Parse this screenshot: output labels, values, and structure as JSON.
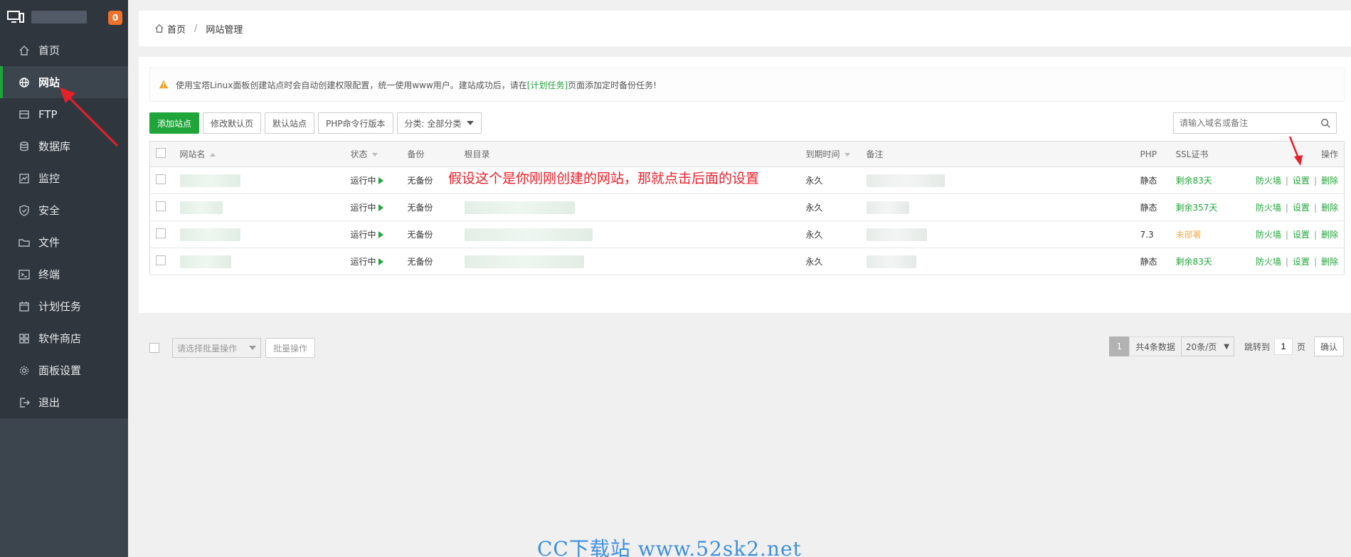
{
  "sidebar": {
    "badge": "0",
    "items": [
      {
        "label": "首页",
        "icon": "home-icon"
      },
      {
        "label": "网站",
        "icon": "globe-icon",
        "active": true
      },
      {
        "label": "FTP",
        "icon": "ftp-icon"
      },
      {
        "label": "数据库",
        "icon": "database-icon"
      },
      {
        "label": "监控",
        "icon": "monitor-icon"
      },
      {
        "label": "安全",
        "icon": "shield-icon"
      },
      {
        "label": "文件",
        "icon": "folder-icon"
      },
      {
        "label": "终端",
        "icon": "terminal-icon"
      },
      {
        "label": "计划任务",
        "icon": "calendar-icon"
      },
      {
        "label": "软件商店",
        "icon": "apps-icon"
      },
      {
        "label": "面板设置",
        "icon": "gear-icon"
      },
      {
        "label": "退出",
        "icon": "logout-icon"
      }
    ]
  },
  "breadcrumb": {
    "home": "首页",
    "sep": "/",
    "current": "网站管理"
  },
  "notice": {
    "before": "使用宝塔Linux面板创建站点时会自动创建权限配置，统一使用www用户。建站成功后，请在",
    "link": "[计划任务]",
    "after": "页面添加定时备份任务!"
  },
  "toolbar": {
    "add": "添加站点",
    "modify_default": "修改默认页",
    "default_site": "默认站点",
    "php_cli": "PHP命令行版本",
    "category": "分类: 全部分类"
  },
  "search": {
    "placeholder": "请输入域名或备注"
  },
  "table": {
    "headers": {
      "name": "网站名",
      "status": "状态",
      "backup": "备份",
      "root": "根目录",
      "expire": "到期时间",
      "remark": "备注",
      "php": "PHP",
      "ssl": "SSL证书",
      "ops": "操作"
    },
    "rows": [
      {
        "status": "运行中",
        "backup": "无备份",
        "expire": "永久",
        "php": "静态",
        "ssl": "剩余83天",
        "ssl_color": "#20a53a"
      },
      {
        "status": "运行中",
        "backup": "无备份",
        "expire": "永久",
        "php": "静态",
        "ssl": "剩余357天",
        "ssl_color": "#20a53a"
      },
      {
        "status": "运行中",
        "backup": "无备份",
        "expire": "永久",
        "php": "7.3",
        "ssl": "未部署",
        "ssl_color": "#f0ad4e"
      },
      {
        "status": "运行中",
        "backup": "无备份",
        "expire": "永久",
        "php": "静态",
        "ssl": "剩余83天",
        "ssl_color": "#20a53a"
      }
    ],
    "op_firewall": "防火墙",
    "op_settings": "设置",
    "op_delete": "删除"
  },
  "batch": {
    "placeholder": "请选择批量操作",
    "button": "批量操作"
  },
  "pager": {
    "current": "1",
    "total": "共4条数据",
    "per_page": "20条/页",
    "jump": "跳转到",
    "page_value": "1",
    "page_unit": "页",
    "confirm": "确认"
  },
  "annotation": "假设这个是你刚刚创建的网站，那就点击后面的设置",
  "watermark": "CC下载站 www.52sk2.net",
  "colors": {
    "accent": "#20a53a",
    "sidebar": "#3c444d",
    "badge": "#f0712b",
    "annotation": "#e8202a"
  }
}
